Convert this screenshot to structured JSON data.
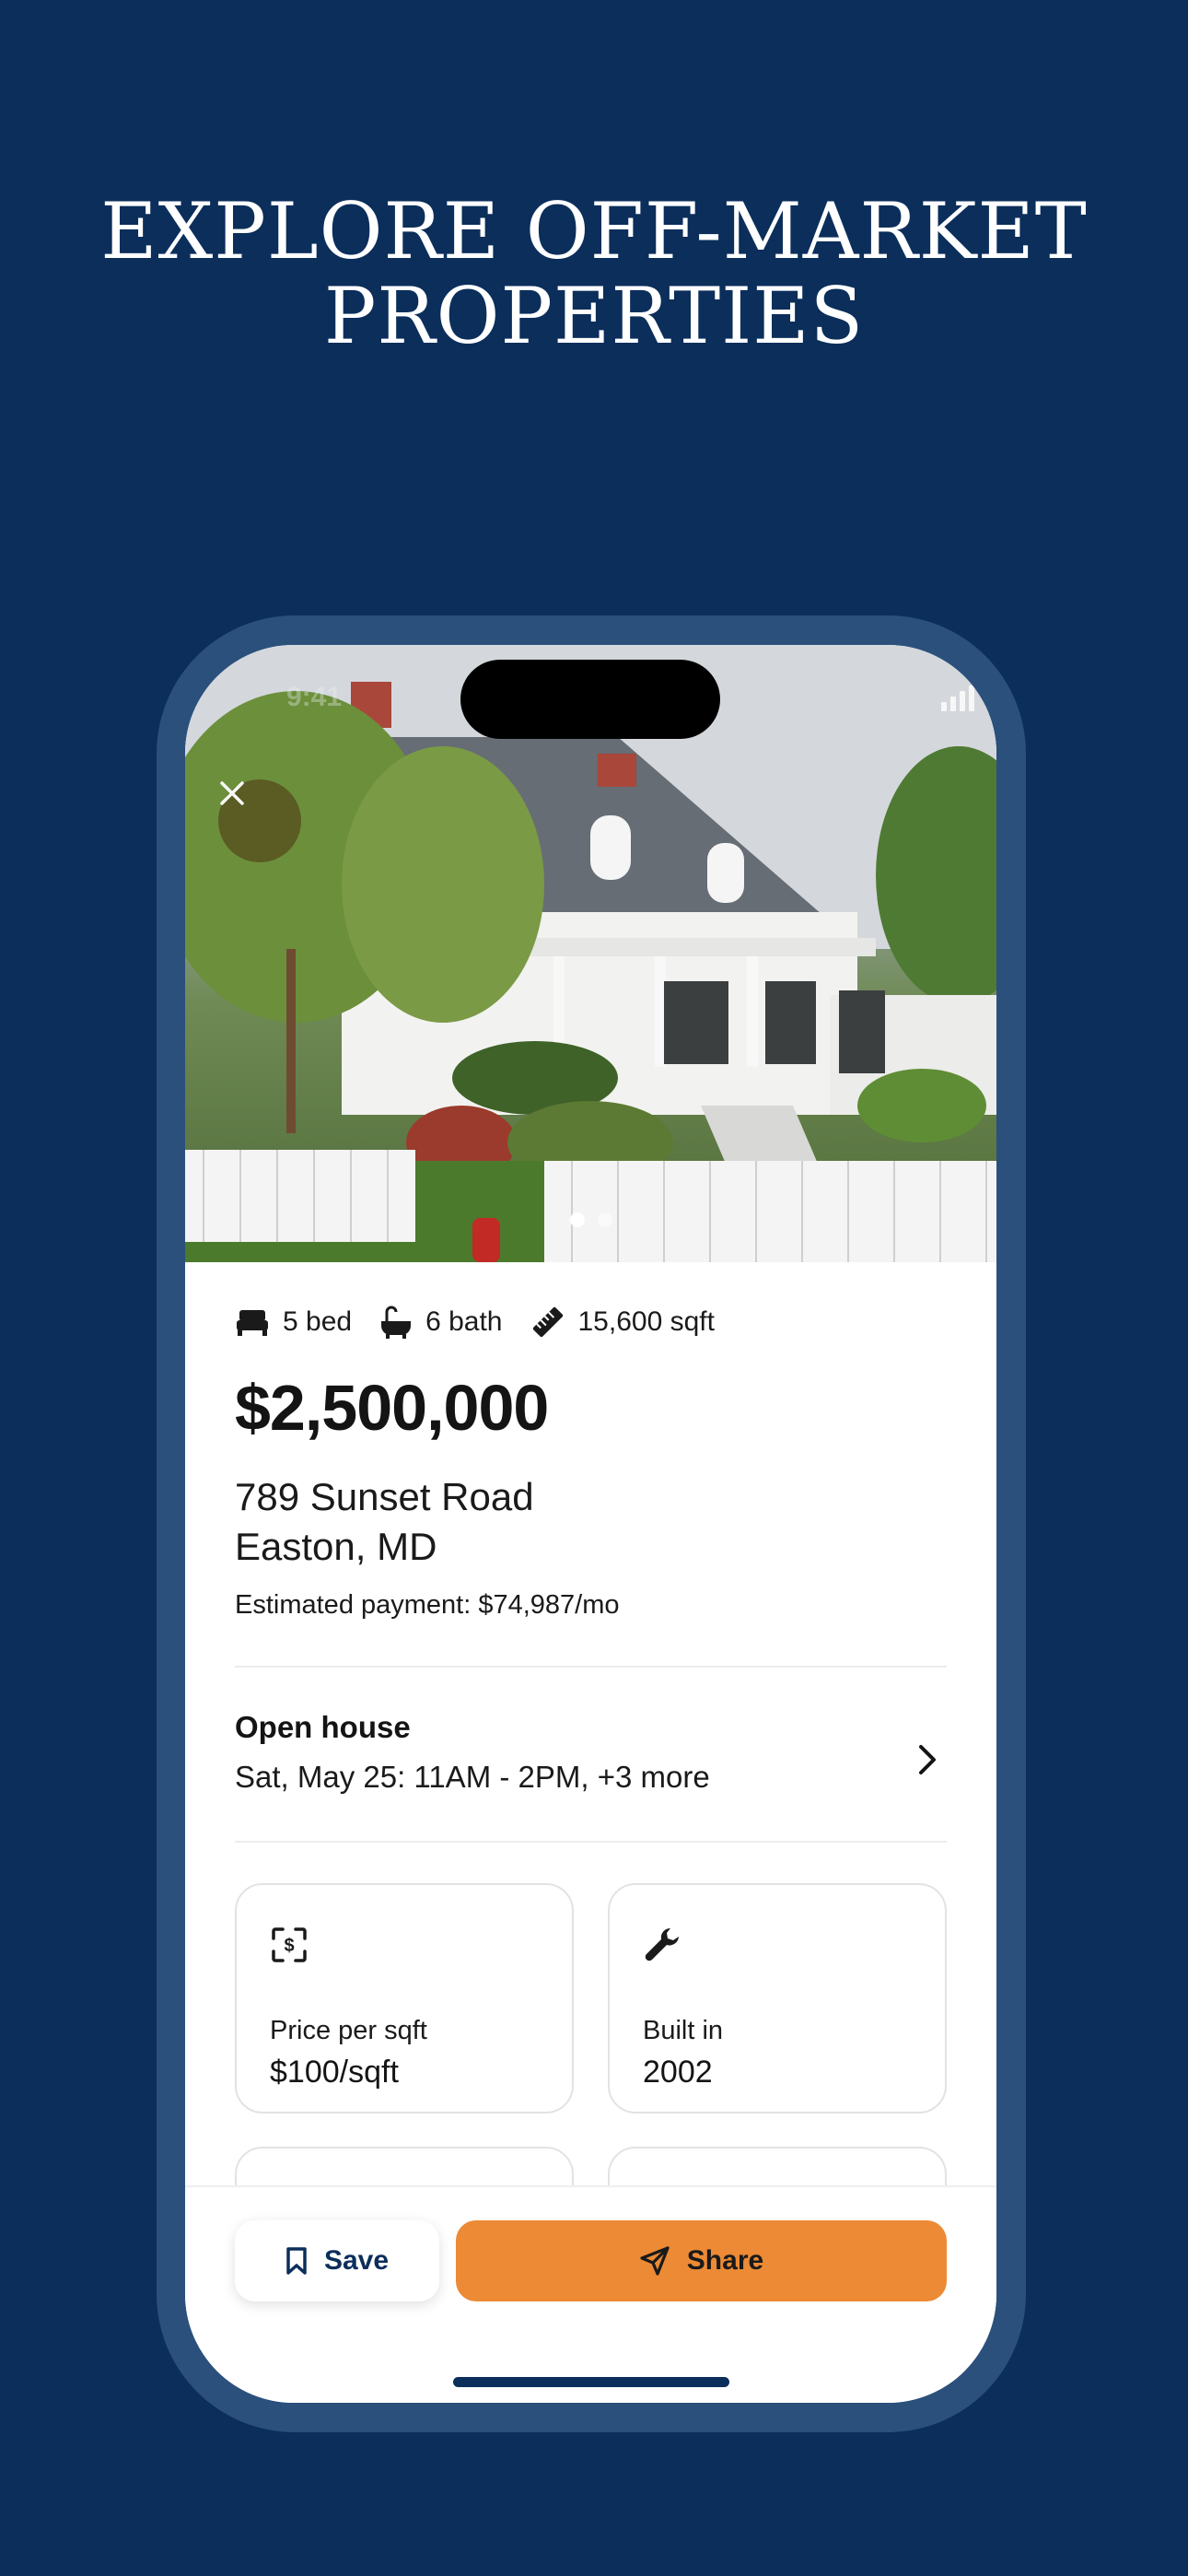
{
  "headline": {
    "line1": "EXPLORE OFF-MARKET",
    "line2": "PROPERTIES"
  },
  "status_bar": {
    "time": "9:41",
    "icons": [
      "signal-icon",
      "wifi-icon",
      "battery-icon"
    ]
  },
  "gallery": {
    "photo_count": 2,
    "active_index": 0
  },
  "listing": {
    "features": [
      {
        "icon": "bed-icon",
        "label": "5 bed"
      },
      {
        "icon": "bathtub-icon",
        "label": "6 bath"
      },
      {
        "icon": "ruler-icon",
        "label": "15,600 sqft"
      }
    ],
    "price": "$2,500,000",
    "address_line1": "789 Sunset Road",
    "address_line2": "Easton, MD",
    "estimated_payment": "Estimated payment: $74,987/mo"
  },
  "open_house": {
    "title": "Open house",
    "detail": "Sat, May 25: 11AM - 2PM, +3 more"
  },
  "facts": [
    {
      "icon": "dollar-scan-icon",
      "label": "Price per sqft",
      "value": "$100/sqft"
    },
    {
      "icon": "wrench-icon",
      "label": "Built in",
      "value": "2002"
    }
  ],
  "actions": {
    "save_label": "Save",
    "share_label": "Share"
  },
  "colors": {
    "background": "#0b2e5b",
    "phone_frame": "#2b507c",
    "share_button": "#ec8a35",
    "close_button": "#5a5a22"
  }
}
